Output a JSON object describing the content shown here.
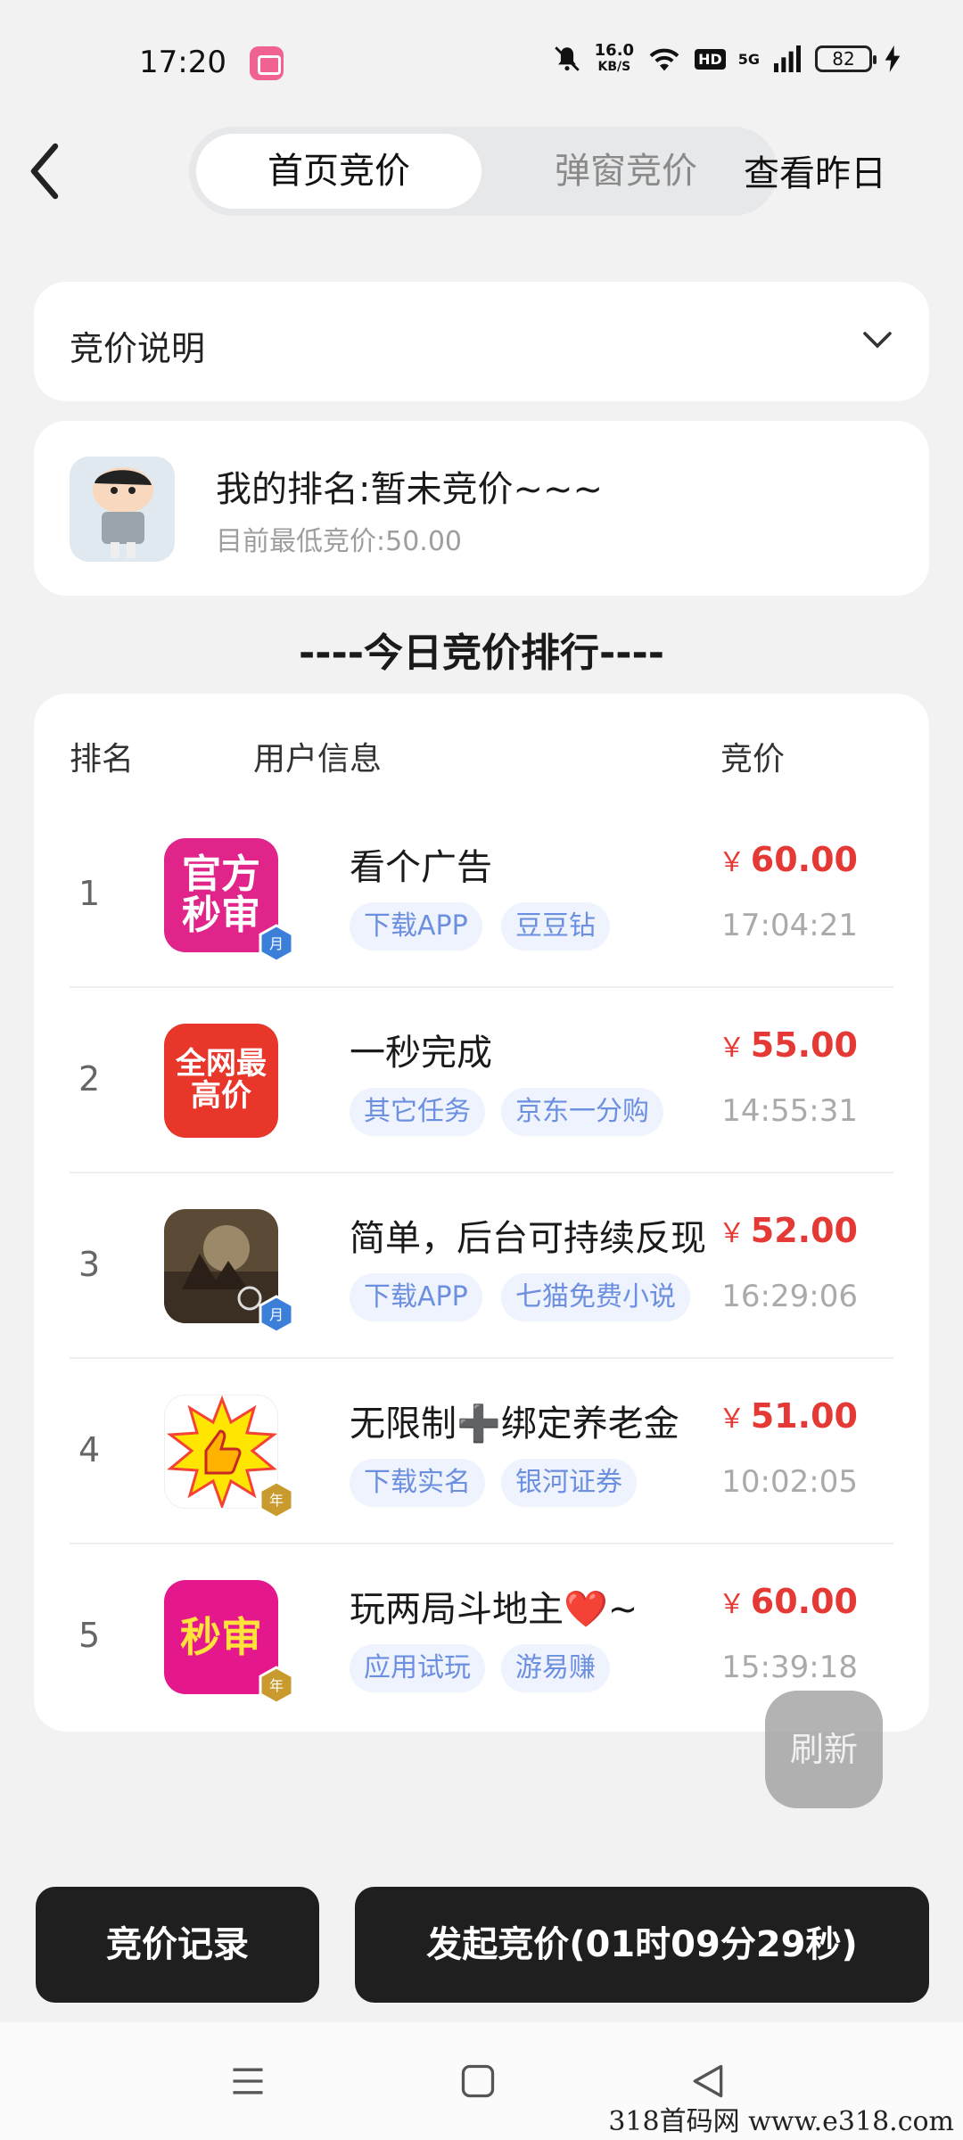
{
  "status_bar": {
    "time": "17:20",
    "net_speed_value": "16.0",
    "net_speed_unit": "KB/S",
    "hd": "HD",
    "signal": "5G",
    "battery": "82",
    "icons": [
      "app-icon",
      "mute-bell-icon",
      "wifi-icon",
      "signal-icon",
      "battery-icon",
      "charging-icon"
    ]
  },
  "header": {
    "tabs": [
      {
        "label": "首页竞价",
        "active": true
      },
      {
        "label": "弹窗竞价",
        "active": false
      }
    ],
    "view_yesterday": "查看昨日"
  },
  "explain": {
    "label": "竞价说明"
  },
  "my_rank": {
    "title": "我的排名:暂未竞价~~~",
    "subtitle": "目前最低竞价:50.00"
  },
  "section_title": "----今日竞价排行----",
  "table": {
    "headers": {
      "rank": "排名",
      "user": "用户信息",
      "price": "竞价"
    },
    "currency": "￥",
    "rows": [
      {
        "rank": "1",
        "thumb_text": "官方秒审",
        "title": "看个广告",
        "tags": [
          "下载APP",
          "豆豆钻"
        ],
        "price": "60.00",
        "time": "17:04:21"
      },
      {
        "rank": "2",
        "thumb_text": "全网最高价",
        "title": "一秒完成",
        "tags": [
          "其它任务",
          "京东一分购"
        ],
        "price": "55.00",
        "time": "14:55:31"
      },
      {
        "rank": "3",
        "thumb_text": "",
        "title": "简单，后台可持续反现",
        "tags": [
          "下载APP",
          "七猫免费小说"
        ],
        "price": "52.00",
        "time": "16:29:06"
      },
      {
        "rank": "4",
        "thumb_text": "",
        "title": "无限制➕绑定养老金",
        "tags": [
          "下载实名",
          "银河证券"
        ],
        "price": "51.00",
        "time": "10:02:05"
      },
      {
        "rank": "5",
        "thumb_text": "秒审",
        "title": "玩两局斗地主❤️~",
        "tags": [
          "应用试玩",
          "游易赚"
        ],
        "price": "60.00",
        "time": "15:39:18"
      }
    ]
  },
  "refresh_label": "刷新",
  "buttons": {
    "record": "竞价记录",
    "start": "发起竞价(01时09分29秒)"
  },
  "watermark": "318首码网   www.e318.com",
  "colors": {
    "accent_price": "#e53935",
    "tag_text": "#6c8fe0",
    "tag_bg": "#eef3fd",
    "button_bg": "#1f1f1f",
    "page_bg": "#f2f2f2"
  }
}
